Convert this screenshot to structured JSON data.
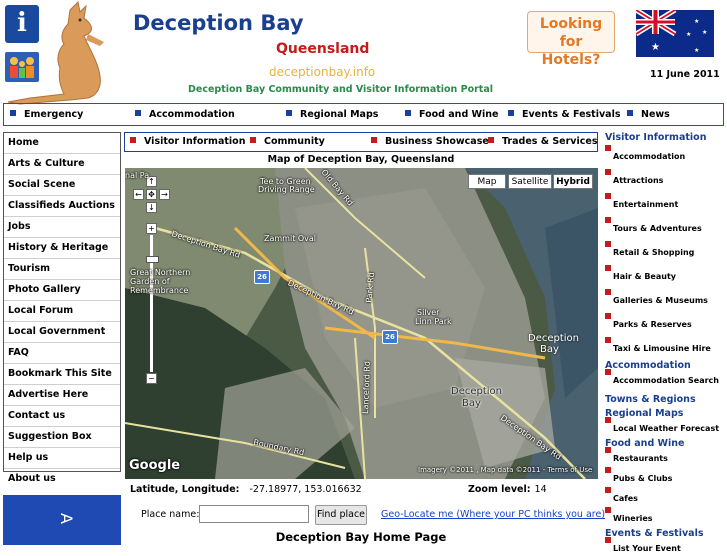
{
  "header": {
    "site_title": "Deception Bay",
    "state": "Queensland",
    "domain": "deceptionbay.info",
    "tagline": "Deception Bay Community and Visitor Information Portal",
    "hotels_line1": "Looking for",
    "hotels_line2": "Hotels?",
    "date": "11 June 2011",
    "info_icon_glyph": "i"
  },
  "top_nav": [
    "Emergency",
    "Accommodation",
    "Regional Maps",
    "Food and Wine",
    "Events & Festivals",
    "News"
  ],
  "left_menu": [
    "Home",
    "Arts & Culture",
    "Social Scene",
    "Classifieds Auctions",
    "Jobs",
    "History & Heritage",
    "Tourism",
    "Photo Gallery",
    "Local Forum",
    "Local Government",
    "FAQ",
    "Bookmark This Site",
    "Advertise Here",
    "Contact us",
    "Suggestion Box",
    "Help us",
    "About us"
  ],
  "left_banner_text": "A",
  "sub_nav": [
    "Visitor Information",
    "Community",
    "Business Showcase",
    "Trades & Services"
  ],
  "map": {
    "title": "Map of Deception Bay, Queensland",
    "types": [
      "Map",
      "Satellite",
      "Hybrid"
    ],
    "selected_type": "Hybrid",
    "labels": {
      "tee": "Tee to Green",
      "driving": "Driving Range",
      "nal": "nal Pa",
      "zammit": "Zammit Oval",
      "gn1": "Great Northern",
      "gn2": "Garden of",
      "gn3": "Remembrance",
      "db_rd_1": "Deception Bay Rd",
      "db_rd_2": "Deception Bay Rd",
      "db_rd_3": "Deception Bay Rd",
      "oldbay": "Old Bay Rd",
      "park": "Park Rd",
      "lan": "Lanceford Rd",
      "boundary": "Boundary Rd",
      "silver1": "Silver",
      "silver2": "Linn Park",
      "water1": "Deception",
      "water2": "Bay",
      "town1": "Deception",
      "town2": "Bay",
      "route": "26",
      "imagery": "Imagery ©2011 , Map data ©2011 - Terms of Use",
      "google": "Google"
    }
  },
  "latlng_label": "Latitude, Longitude:",
  "latlng_value": "-27.18977, 153.016632",
  "zoom_label": "Zoom level:",
  "zoom_value": "14",
  "place_label": "Place name:",
  "place_value": "",
  "find_label": "Find place",
  "geo_link": "Geo-Locate me (Where your PC thinks you are)",
  "home_heading": "Deception Bay Home Page",
  "right_col": {
    "visitor_heading": "Visitor Information",
    "visitor_items": [
      "Accommodation",
      "Attractions",
      "Entertainment",
      "Tours & Adventures",
      "Retail & Shopping",
      "Hair & Beauty",
      "Galleries & Museums",
      "Parks & Reserves",
      "Taxi & Limousine Hire"
    ],
    "accom_heading": "Accommodation",
    "accom_items": [
      "Accommodation Search"
    ],
    "towns_heading": "Towns & Regions",
    "maps_heading": "Regional Maps",
    "maps_items": [
      "Local Weather Forecast"
    ],
    "food_heading": "Food and Wine",
    "food_items": [
      "Restaurants",
      "Pubs & Clubs",
      "Cafes",
      "Wineries"
    ],
    "events_heading": "Events & Festivals",
    "events_items": [
      "List Your Event"
    ]
  },
  "colors": {
    "title_blue": "#1a3f8e",
    "state_red": "#c41b1b",
    "domain_gold": "#e3b72a",
    "tagline_green": "#2a8a4a",
    "hotels_orange": "#e07a27",
    "link_blue": "#1a3fc8"
  }
}
